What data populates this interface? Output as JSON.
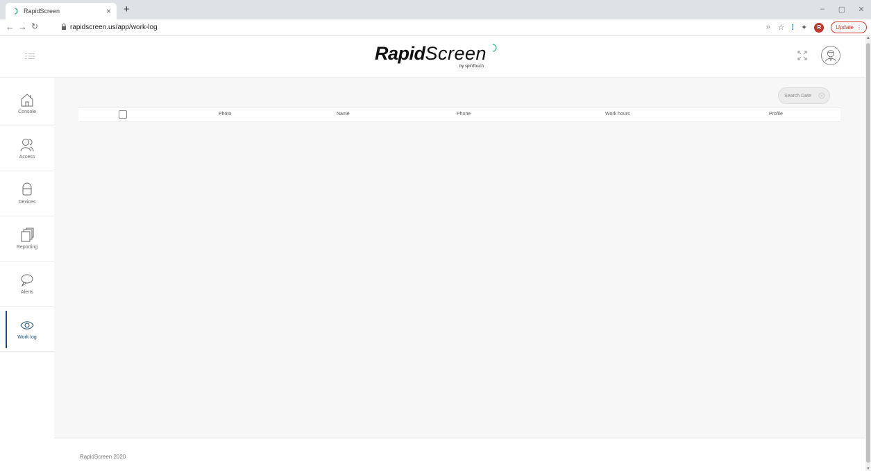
{
  "browser": {
    "tab_title": "RapidScreen",
    "tab_close": "×",
    "new_tab": "+",
    "url": "rapidscreen.us/app/work-log",
    "profile_initial": "R",
    "update_label": "Update",
    "window_controls": [
      "–",
      "▢",
      "✕"
    ]
  },
  "header": {
    "logo_bold": "Rapid",
    "logo_light": "Screen",
    "logo_byline": "by spinTouch"
  },
  "sidebar": {
    "items": [
      {
        "label": "Console",
        "icon": "home-icon"
      },
      {
        "label": "Access",
        "icon": "users-icon"
      },
      {
        "label": "Devices",
        "icon": "device-icon"
      },
      {
        "label": "Reporting",
        "icon": "reports-icon"
      },
      {
        "label": "Alerts",
        "icon": "chat-bubble-icon"
      },
      {
        "label": "Work log",
        "icon": "eye-icon",
        "active": true
      }
    ]
  },
  "main": {
    "search_placeholder": "Search Date",
    "table_columns": [
      "Photo",
      "Name",
      "Phone",
      "Work hours",
      "Profile"
    ]
  },
  "footer": {
    "text": "RapidScreen 2020"
  },
  "colors": {
    "accent": "#1f4f7a",
    "update_red": "#d93025",
    "content_bg": "#f7f7f7"
  }
}
